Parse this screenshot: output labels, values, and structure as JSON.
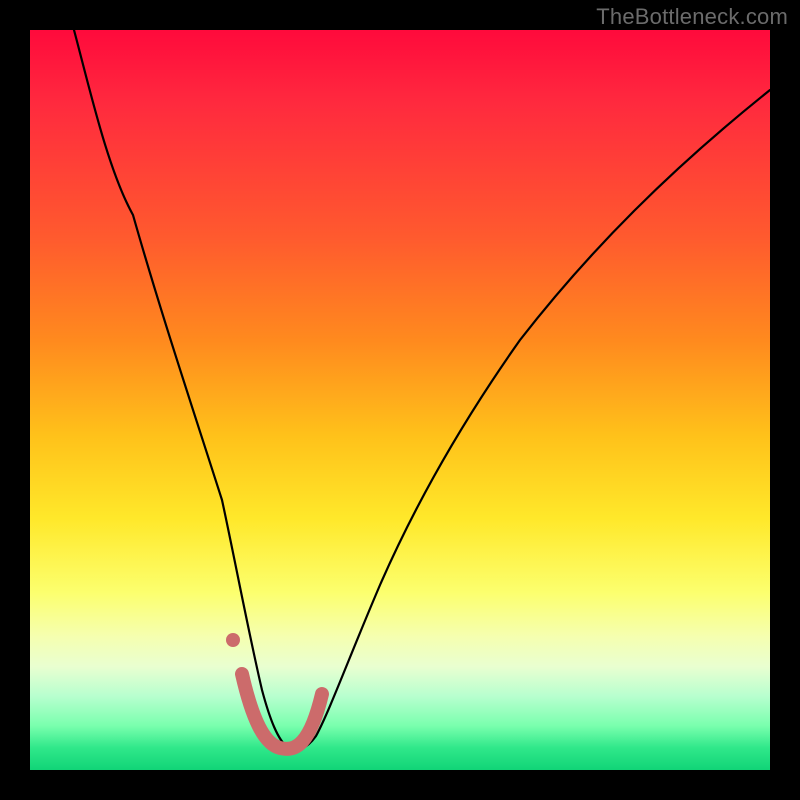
{
  "watermark": "TheBottleneck.com",
  "chart_data": {
    "type": "line",
    "title": "",
    "xlabel": "",
    "ylabel": "",
    "xlim": [
      0,
      100
    ],
    "ylim": [
      0,
      100
    ],
    "grid": false,
    "legend": false,
    "background_gradient": {
      "direction": "vertical",
      "stops": [
        {
          "pos": 0,
          "color": "#ff0a3c"
        },
        {
          "pos": 50,
          "color": "#ffd91f"
        },
        {
          "pos": 85,
          "color": "#f0ffc0"
        },
        {
          "pos": 100,
          "color": "#11d477"
        }
      ]
    },
    "series": [
      {
        "name": "bottleneck-curve",
        "x": [
          6,
          10,
          14,
          18,
          22,
          26,
          28,
          30,
          32,
          34,
          36,
          38,
          42,
          46,
          52,
          58,
          66,
          76,
          86,
          100
        ],
        "y": [
          100,
          88,
          75,
          62,
          48,
          32,
          22,
          12,
          5,
          3,
          3,
          5,
          12,
          22,
          36,
          48,
          60,
          72,
          82,
          92
        ]
      }
    ],
    "markers": {
      "name": "optimal-range",
      "color": "#cc6b6b",
      "points": [
        {
          "x": 28.5,
          "y": 13
        },
        {
          "x": 30,
          "y": 6
        },
        {
          "x": 32,
          "y": 3
        },
        {
          "x": 35,
          "y": 3
        },
        {
          "x": 37,
          "y": 5
        },
        {
          "x": 39,
          "y": 10
        }
      ],
      "isolated_dot": {
        "x": 27.5,
        "y": 18
      }
    }
  }
}
